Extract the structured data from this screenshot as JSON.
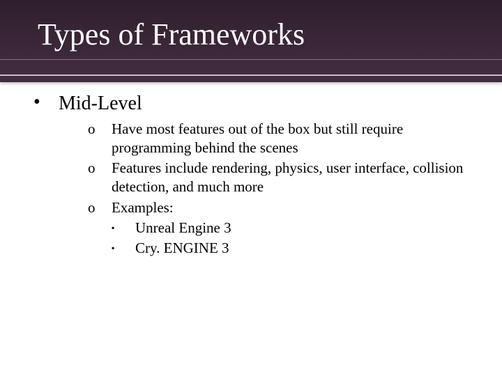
{
  "title": "Types of Frameworks",
  "bullet": {
    "marker": "•",
    "text": "Mid-Level"
  },
  "subitems": [
    {
      "marker": "o",
      "text": "Have most features out of the box but still require programming behind the scenes"
    },
    {
      "marker": "o",
      "text": "Features include rendering, physics, user interface, collision detection, and much more"
    },
    {
      "marker": "o",
      "text": "Examples:"
    }
  ],
  "examples": [
    {
      "marker": "▪",
      "text": "Unreal Engine 3"
    },
    {
      "marker": "▪",
      "text": "Cry. ENGINE 3"
    }
  ]
}
